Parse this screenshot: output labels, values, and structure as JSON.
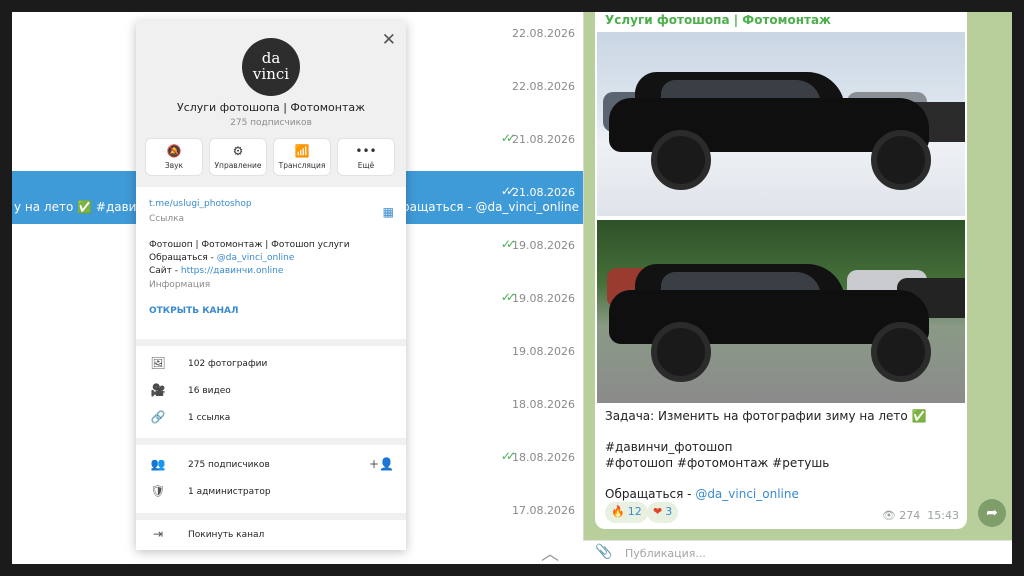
{
  "list": {
    "rows": [
      {
        "date": "22.08.2026",
        "read": false
      },
      {
        "date": "22.08.2026",
        "read": false
      },
      {
        "date": "21.08.2026",
        "read": true
      },
      {
        "date": "21.08.2026",
        "read": true,
        "selected": true,
        "text_left": "у на лето ✅ #давинчи_",
        "text_right": "ращаться - @da_vinci_online"
      },
      {
        "date": "19.08.2026",
        "read": true
      },
      {
        "date": "19.08.2026",
        "read": true
      },
      {
        "date": "19.08.2026",
        "read": false
      },
      {
        "date": "18.08.2026",
        "read": false
      },
      {
        "date": "18.08.2026",
        "read": true
      },
      {
        "date": "17.08.2026",
        "read": false
      }
    ],
    "read_mark": "✓✓"
  },
  "profile": {
    "avatar_text_1": "da",
    "avatar_text_2": "vinci",
    "title": "Услуги фотошопа | Фотомонтаж",
    "subscribers": "275 подписчиков",
    "actions": [
      {
        "icon": "bell-off-icon",
        "glyph": "🔕",
        "label": "Звук"
      },
      {
        "icon": "sliders-icon",
        "glyph": "⚙",
        "label": "Управление"
      },
      {
        "icon": "broadcast-icon",
        "glyph": "📶",
        "label": "Трансляция"
      },
      {
        "icon": "more-icon",
        "glyph": "•••",
        "label": "Ещё"
      }
    ],
    "link": "t.me/uslugi_photoshop",
    "link_label": "Ссылка",
    "desc_line1": "Фотошоп | Фотомонтаж | Фотошоп услуги",
    "desc_line2_prefix": "Обращаться - ",
    "desc_line2_link": "@da_vinci_online",
    "desc_line3_prefix": "Сайт - ",
    "desc_line3_link": "https://давинчи.online",
    "desc_label": "Информация",
    "open_channel": "ОТКРЫТЬ КАНАЛ",
    "media": [
      {
        "icon": "photo-icon",
        "glyph": "🖼",
        "label": "102 фотографии"
      },
      {
        "icon": "video-icon",
        "glyph": "🎥",
        "label": "16 видео"
      },
      {
        "icon": "link-icon",
        "glyph": "🔗",
        "label": "1 ссылка"
      }
    ],
    "members": [
      {
        "icon": "users-icon",
        "glyph": "👥",
        "label": "275 подписчиков"
      },
      {
        "icon": "admin-shield-icon",
        "glyph": "🛡",
        "label": "1 администратор"
      }
    ],
    "add_member_glyph": "+👤",
    "leave": {
      "icon": "leave-icon",
      "glyph": "⇥",
      "label": "Покинуть канал"
    }
  },
  "post": {
    "channel_title": "Услуги фотошопа | Фотомонтаж",
    "text_task": "Задача: Изменить на фотографии зиму на лето ✅",
    "tags1": "#давинчи_фотошоп",
    "tags2": "#фотошоп #фотомонтаж #ретушь",
    "contact_prefix": "Обращаться - ",
    "contact_link": "@da_vinci_online",
    "reactions": [
      {
        "emoji": "🔥",
        "count": "12"
      },
      {
        "emoji": "❤",
        "count": "3"
      }
    ],
    "views": "274",
    "time": "15:43"
  },
  "input": {
    "placeholder": "Публикация..."
  },
  "colors": {
    "accent": "#3f9ad8",
    "channel_title": "#4cae4c",
    "link": "#3a8ad0",
    "read_check": "#4cb050"
  }
}
